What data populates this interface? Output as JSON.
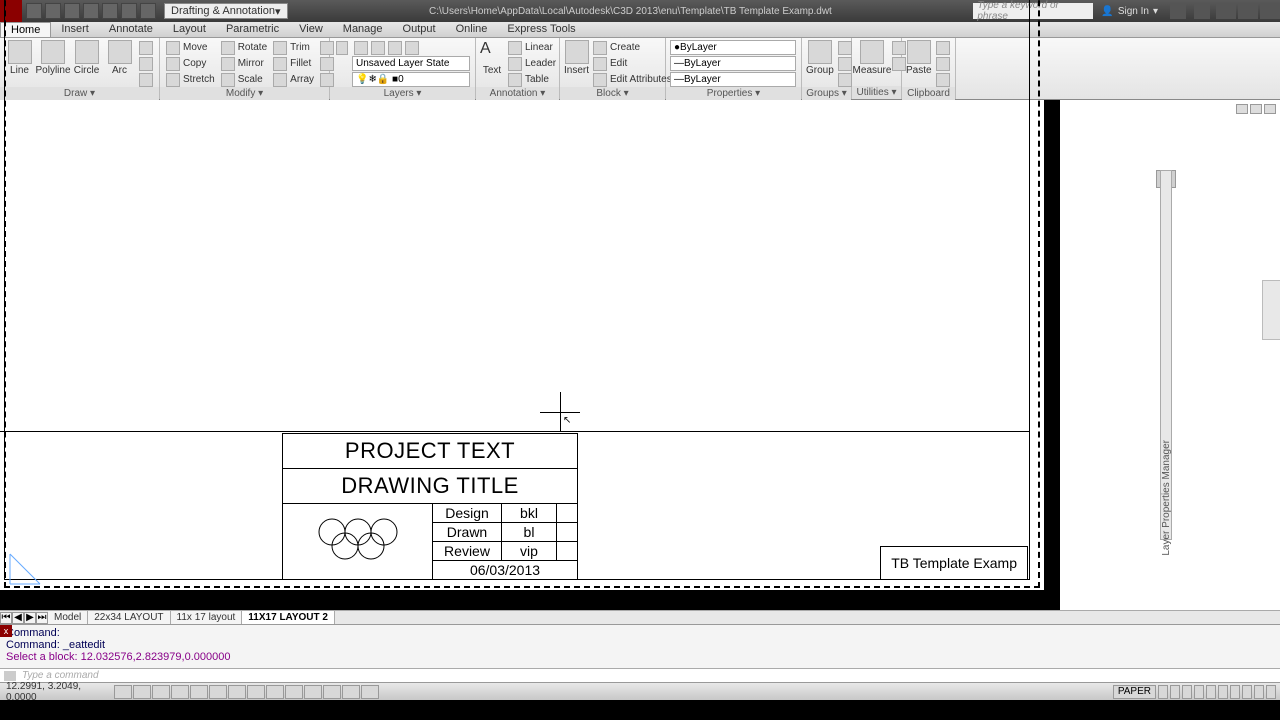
{
  "titlebar": {
    "workspace": "Drafting & Annotation",
    "path": "C:\\Users\\Home\\AppData\\Local\\Autodesk\\C3D 2013\\enu\\Template\\TB Template Examp.dwt",
    "search_placeholder": "Type a keyword or phrase",
    "signin": "Sign In"
  },
  "tabs": [
    "Home",
    "Insert",
    "Annotate",
    "Layout",
    "Parametric",
    "View",
    "Manage",
    "Output",
    "Online",
    "Express Tools"
  ],
  "active_tab": "Home",
  "ribbon": {
    "draw": {
      "title": "Draw",
      "items": [
        "Line",
        "Polyline",
        "Circle",
        "Arc"
      ]
    },
    "modify": {
      "title": "Modify",
      "row1": [
        "Move",
        "Rotate",
        "Trim"
      ],
      "row2": [
        "Copy",
        "Mirror",
        "Fillet"
      ],
      "row3": [
        "Stretch",
        "Scale",
        "Array"
      ]
    },
    "layers": {
      "title": "Layers",
      "state": "Unsaved Layer State",
      "current": "0"
    },
    "annotation": {
      "title": "Annotation",
      "text": "Text",
      "row": [
        "Linear",
        "Leader",
        "Table"
      ]
    },
    "block": {
      "title": "Block",
      "insert": "Insert",
      "row": [
        "Create",
        "Edit",
        "Edit Attributes"
      ]
    },
    "properties": {
      "title": "Properties",
      "bylayer": "ByLayer"
    },
    "groups": {
      "title": "Groups",
      "btn": "Group"
    },
    "utilities": {
      "title": "Utilities",
      "btn": "Measure"
    },
    "clipboard": {
      "title": "Clipboard",
      "btn": "Paste"
    }
  },
  "titleblock": {
    "project": "PROJECT TEXT",
    "drawing": "DRAWING TITLE",
    "rows": [
      {
        "k": "Design",
        "v": "bkl"
      },
      {
        "k": "Drawn",
        "v": "bl"
      },
      {
        "k": "Review",
        "v": "vip"
      }
    ],
    "date": "06/03/2013"
  },
  "stamp": "TB Template Examp",
  "dock_label": "Layer Properties Manager",
  "layout_tabs": [
    "Model",
    "22x34 LAYOUT",
    "11x 17 layout",
    "11X17 LAYOUT 2"
  ],
  "active_layout": "11X17 LAYOUT 2",
  "command": {
    "l1": "Command:",
    "l2": "Command: _eattedit",
    "l3": "Select a block: 12.032576,2.823979,0.000000",
    "prompt": "Type a command"
  },
  "status": {
    "coords": "12.2991, 3.2049, 0.0000",
    "space": "PAPER"
  }
}
